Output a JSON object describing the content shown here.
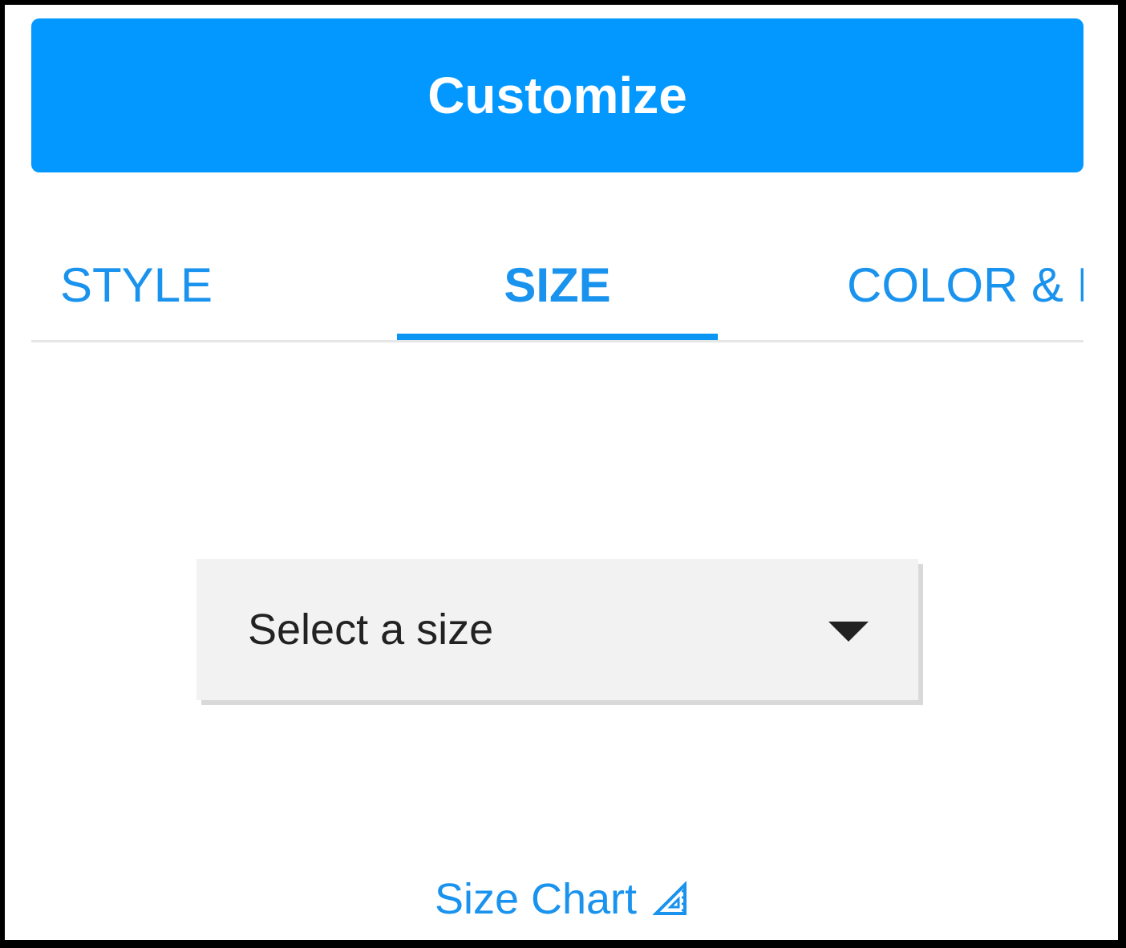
{
  "header": {
    "customize_label": "Customize"
  },
  "tabs": [
    {
      "label": "STYLE",
      "active": false
    },
    {
      "label": "SIZE",
      "active": true
    },
    {
      "label": "COLOR & F",
      "active": false
    }
  ],
  "size_select": {
    "placeholder": "Select a size",
    "icon": "caret-down-icon"
  },
  "size_chart": {
    "label": "Size Chart",
    "icon": "ruler-triangle-icon"
  },
  "colors": {
    "accent": "#0398ff",
    "tab_text": "#1a93ee",
    "select_bg": "#f2f2f2",
    "text_dark": "#222222"
  }
}
